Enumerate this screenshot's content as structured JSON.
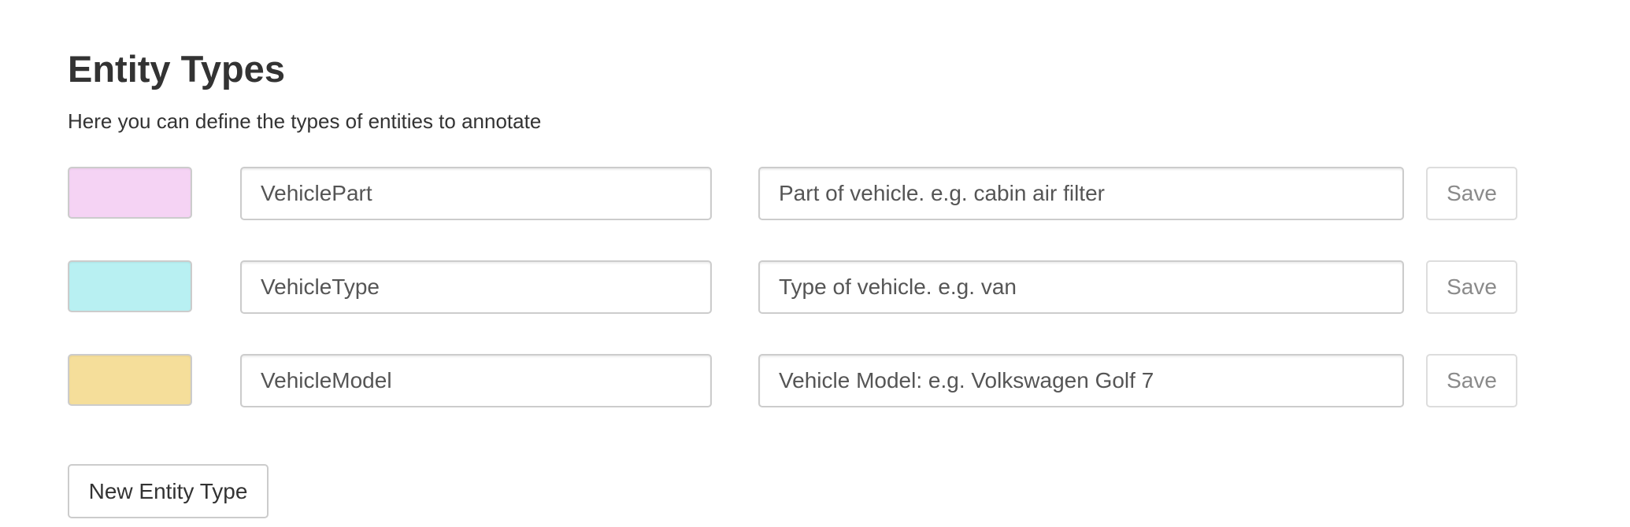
{
  "header": {
    "title": "Entity Types",
    "subtitle": "Here you can define the types of entities to annotate"
  },
  "entities": [
    {
      "color": "#f5d3f4",
      "name": "VehiclePart",
      "description": "Part of vehicle. e.g. cabin air filter",
      "save_label": "Save"
    },
    {
      "color": "#b8f0f2",
      "name": "VehicleType",
      "description": "Type of vehicle. e.g. van",
      "save_label": "Save"
    },
    {
      "color": "#f5de9a",
      "name": "VehicleModel",
      "description": "Vehicle Model: e.g. Volkswagen Golf 7",
      "save_label": "Save"
    }
  ],
  "actions": {
    "new_entity_label": "New Entity Type"
  }
}
